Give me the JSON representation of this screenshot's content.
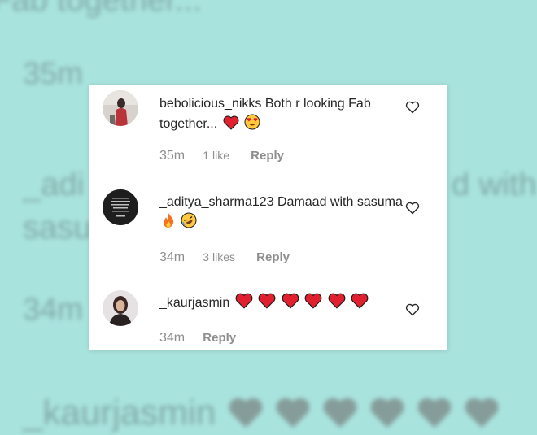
{
  "background": {
    "top_text": "Fab together...",
    "time_1": "35m",
    "likes_1": "1 like",
    "reply_1": "Reply",
    "user_2_partial": "_adi",
    "text_2_partial": "sasu",
    "text_2_right": "d with",
    "time_2": "34m",
    "user_3": "_kaurjasmin"
  },
  "comments": [
    {
      "username": "bebolicious_nikks",
      "text": "Both r looking Fab together...",
      "emojis": [
        "red-heart",
        "heart-eyes-face"
      ],
      "time": "35m",
      "likes": "1 like",
      "reply": "Reply"
    },
    {
      "username": "_aditya_sharma123",
      "text": "Damaad with sasuma",
      "emojis": [
        "fire",
        "rolling-laughing-face"
      ],
      "time": "34m",
      "likes": "3 likes",
      "reply": "Reply"
    },
    {
      "username": "_kaurjasmin",
      "text": "",
      "emojis": [
        "red-heart",
        "red-heart",
        "red-heart",
        "red-heart",
        "red-heart",
        "red-heart"
      ],
      "time": "34m",
      "likes": "",
      "reply": "Reply"
    }
  ],
  "colors": {
    "background": "#a9e3de",
    "card": "#ffffff",
    "text": "#262626",
    "meta": "#8e8e8e",
    "heart": "#e0202e"
  }
}
